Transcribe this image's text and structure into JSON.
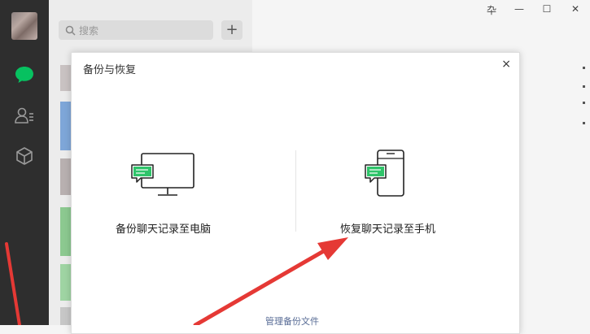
{
  "search": {
    "placeholder": "搜索"
  },
  "window_controls": {
    "pin": "卆",
    "minimize": "—",
    "maximize": "☐",
    "close": "✕"
  },
  "dialog": {
    "title": "备份与恢复",
    "close_label": "×",
    "backup_to_pc_label": "备份聊天记录至电脑",
    "restore_to_phone_label": "恢复聊天记录至手机",
    "manage_backup_label": "管理备份文件"
  },
  "colors": {
    "sidebar": "#2e2e2e",
    "active_chat_icon": "#07c160",
    "link": "#576b95",
    "arrow": "#e53935"
  },
  "icons": [
    "chat-icon",
    "contacts-icon",
    "cube-icon",
    "search-icon",
    "monitor-icon",
    "phone-icon",
    "speech-bubble-icon"
  ]
}
